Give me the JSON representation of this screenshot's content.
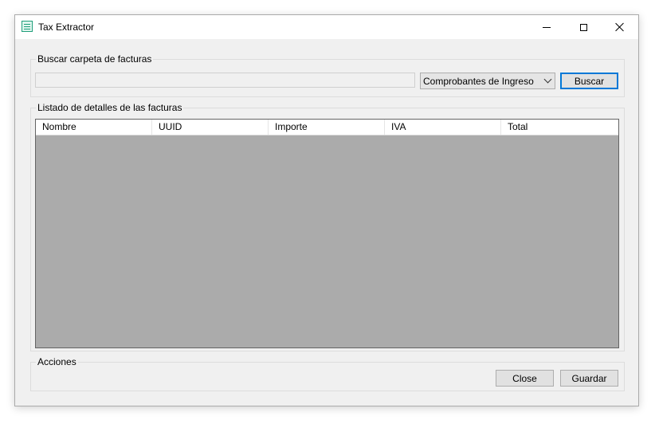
{
  "window": {
    "title": "Tax Extractor",
    "icon": "app-icon"
  },
  "search_group": {
    "legend": "Buscar carpeta de facturas",
    "path_value": "",
    "type_select": {
      "selected": "Comprobantes de Ingreso"
    },
    "search_button": "Buscar"
  },
  "list_group": {
    "legend": "Listado de detalles de las facturas",
    "columns": [
      "Nombre",
      "UUID",
      "Importe",
      "IVA",
      "Total"
    ],
    "rows": []
  },
  "actions_group": {
    "legend": "Acciones",
    "close_button": "Close",
    "save_button": "Guardar"
  },
  "colors": {
    "accent": "#0078d7",
    "grid_background": "#ababab",
    "icon_green": "#1f9e7a"
  }
}
